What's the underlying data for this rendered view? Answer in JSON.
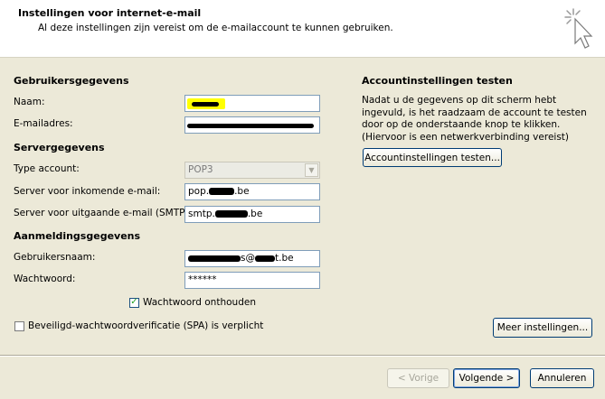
{
  "header": {
    "title": "Instellingen voor internet-e-mail",
    "subtitle": "Al deze instellingen zijn vereist om de e-mailaccount te kunnen gebruiken."
  },
  "user_info": {
    "section": "Gebruikersgegevens",
    "name_label": "Naam:",
    "name_value": "",
    "email_label": "E-mailadres:",
    "email_value": ""
  },
  "server_info": {
    "section": "Servergegevens",
    "type_label": "Type account:",
    "type_value": "POP3",
    "incoming_label": "Server voor inkomende e-mail:",
    "incoming_prefix": "pop.",
    "incoming_suffix": ".be",
    "outgoing_label": "Server voor uitgaande e-mail (SMTP):",
    "outgoing_prefix": "smtp.",
    "outgoing_suffix": ".be"
  },
  "login_info": {
    "section": "Aanmeldingsgegevens",
    "username_label": "Gebruikersnaam:",
    "username_middle": "s@",
    "username_suffix": "t.be",
    "password_label": "Wachtwoord:",
    "password_value": "******",
    "remember_label": "Wachtwoord onthouden",
    "remember_checked": true,
    "spa_label": "Beveiligd-wachtwoordverificatie (SPA) is verplicht",
    "spa_checked": false
  },
  "test": {
    "section": "Accountinstellingen testen",
    "description": "Nadat u de gegevens op dit scherm hebt ingevuld, is het raadzaam de account te testen door op de onderstaande knop te klikken. (Hiervoor is een netwerkverbinding vereist)",
    "button": "Accountinstellingen testen..."
  },
  "buttons": {
    "more_settings": "Meer instellingen...",
    "back": "< Vorige",
    "next": "Volgende >",
    "cancel": "Annuleren"
  },
  "colors": {
    "dialog_bg": "#ece9d8",
    "header_bg": "#ffffff",
    "field_border": "#7f9db9",
    "highlight": "#ffff00"
  }
}
